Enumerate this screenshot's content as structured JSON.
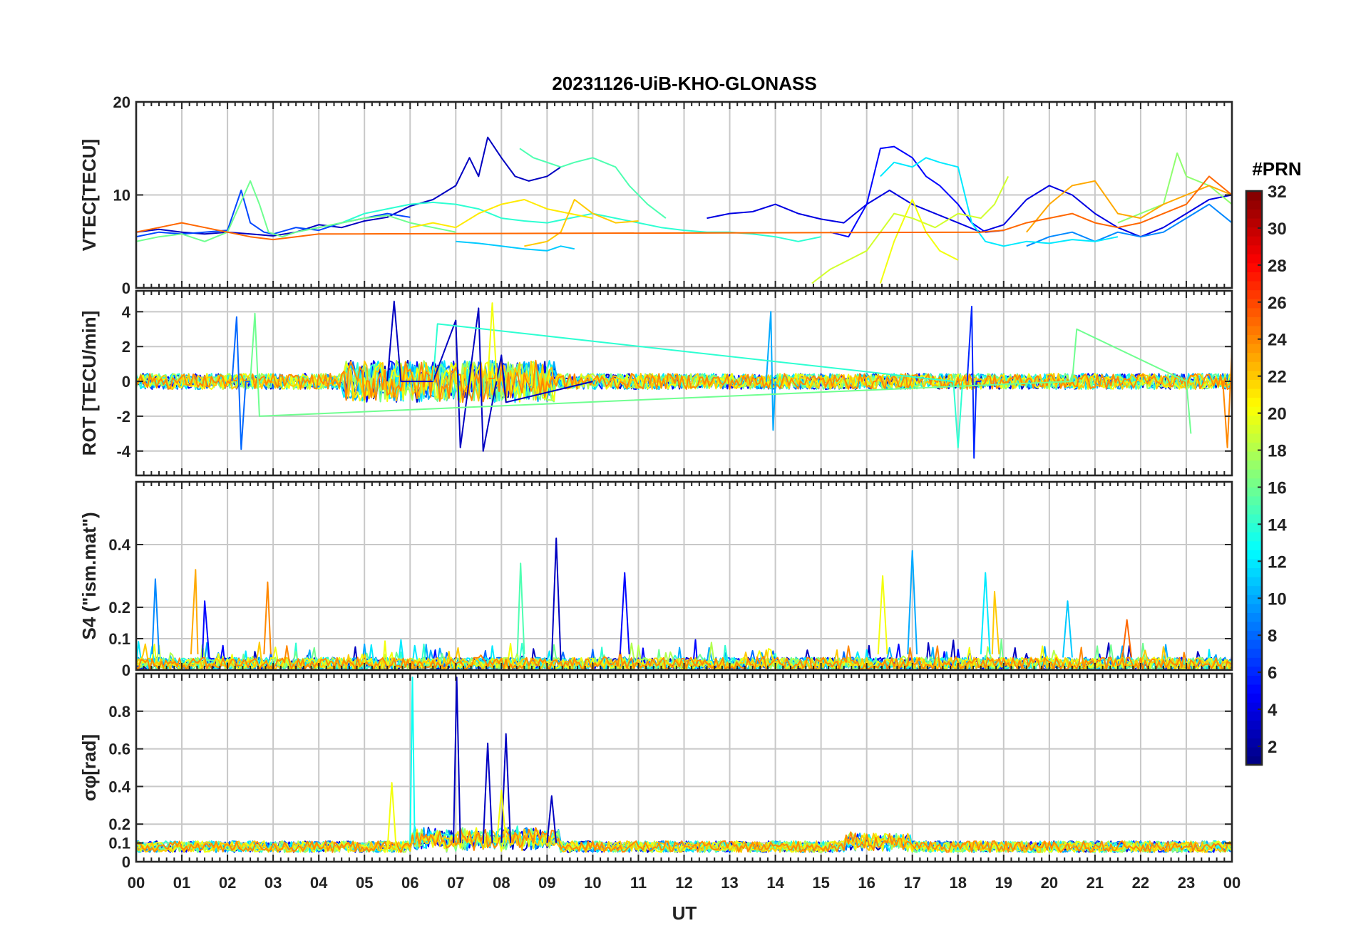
{
  "chart_data": {
    "type": "line",
    "title": "20231126-UiB-KHO-GLONASS",
    "xlabel": "UT",
    "x_tick_labels": [
      "00",
      "01",
      "02",
      "03",
      "04",
      "05",
      "06",
      "07",
      "08",
      "09",
      "10",
      "11",
      "12",
      "13",
      "14",
      "15",
      "16",
      "17",
      "18",
      "19",
      "20",
      "21",
      "22",
      "23",
      "00"
    ],
    "xlim": [
      0,
      24
    ],
    "colorbar": {
      "title": "#PRN",
      "range": [
        1,
        32
      ],
      "ticks": [
        2,
        4,
        6,
        8,
        10,
        12,
        14,
        16,
        18,
        20,
        22,
        24,
        26,
        28,
        30,
        32
      ],
      "colormap": "jet"
    },
    "panels": [
      {
        "id": "vtec",
        "ylabel": "VTEC[TECU]",
        "ylim": [
          0,
          20
        ],
        "yticks": [
          0,
          10,
          20
        ],
        "series": [
          {
            "prn": 3,
            "x": [
              0,
              0.5,
              1,
              1.5,
              2,
              2.5,
              3,
              3.5,
              4,
              4.5,
              5,
              5.5,
              6,
              6.5,
              7,
              7.3,
              7.5,
              7.7,
              8,
              8.3,
              8.6,
              9,
              9.3
            ],
            "y": [
              6,
              6.3,
              6,
              5.8,
              6,
              5.8,
              5.6,
              6,
              6.8,
              6.5,
              7.2,
              7.6,
              8.8,
              9.5,
              11,
              14,
              12,
              16.2,
              14,
              12,
              11.5,
              12,
              13
            ]
          },
          {
            "prn": 4,
            "x": [
              12.5,
              13,
              13.5,
              14,
              14.5,
              15,
              15.5,
              16,
              16.5,
              17,
              17.5,
              18,
              18.5,
              19,
              19.5,
              20,
              20.5,
              21,
              21.5,
              22,
              22.5,
              23,
              23.5,
              24
            ],
            "y": [
              7.5,
              8,
              8.2,
              9,
              8,
              7.4,
              7,
              9,
              10.5,
              9,
              8,
              7,
              6,
              6.8,
              9.5,
              11,
              10,
              8,
              6.5,
              5.5,
              6.5,
              8,
              9.5,
              10
            ]
          },
          {
            "prn": 5,
            "x": [
              15.2,
              15.6,
              16,
              16.3,
              16.6,
              17,
              17.3,
              17.6,
              18,
              18.3,
              18.6,
              19
            ],
            "y": [
              6,
              5.5,
              9,
              15,
              15.2,
              14,
              12,
              11,
              9,
              7,
              6,
              6.2
            ]
          },
          {
            "prn": 7,
            "x": [
              0,
              0.5,
              1,
              1.5,
              2,
              2.3,
              2.5,
              2.8,
              3,
              3.5,
              4,
              4.5,
              5,
              5.5,
              6
            ],
            "y": [
              5.5,
              6,
              5.8,
              6,
              6.2,
              10.5,
              7,
              6,
              5.8,
              6.5,
              6.2,
              7,
              7.5,
              8,
              7.6
            ]
          },
          {
            "prn": 9,
            "x": [
              19.5,
              20,
              20.5,
              21,
              21.5,
              22,
              22.5,
              23,
              23.5,
              24
            ],
            "y": [
              4.5,
              5.5,
              6,
              5,
              6,
              5.5,
              6,
              7.5,
              9,
              7
            ]
          },
          {
            "prn": 11,
            "x": [
              7,
              7.5,
              8,
              8.5,
              9,
              9.3,
              9.6
            ],
            "y": [
              5,
              4.8,
              4.5,
              4.2,
              4,
              4.5,
              4.2
            ]
          },
          {
            "prn": 12,
            "x": [
              16.3,
              16.6,
              17,
              17.3,
              17.6,
              18,
              18.3,
              18.6,
              19,
              19.5,
              20,
              20.5,
              21,
              21.5
            ],
            "y": [
              12,
              13.5,
              13,
              14,
              13.5,
              13,
              7,
              5,
              4.5,
              5,
              4.8,
              5.2,
              5,
              5.5
            ]
          },
          {
            "prn": 14,
            "x": [
              3.5,
              4,
              4.5,
              5,
              5.5,
              6,
              6.5,
              7,
              7.5,
              8,
              8.5,
              9,
              9.5,
              10,
              10.5,
              11,
              11.5,
              12,
              12.5,
              13,
              13.5,
              14,
              14.5,
              15
            ],
            "y": [
              6,
              6.5,
              7,
              8,
              8.5,
              9,
              9.2,
              9,
              8.5,
              7.5,
              7.2,
              7,
              7.5,
              8,
              7.5,
              7,
              6.5,
              6.2,
              6,
              6,
              5.8,
              5.5,
              5,
              5.5
            ]
          },
          {
            "prn": 15,
            "x": [
              8.4,
              8.7,
              9,
              9.3,
              9.6,
              10,
              10.5,
              10.8,
              11.2,
              11.6
            ],
            "y": [
              15,
              14,
              13.5,
              13,
              13.5,
              14,
              13,
              11,
              9,
              7.5
            ]
          },
          {
            "prn": 16,
            "x": [
              0,
              0.5,
              1,
              1.5,
              2,
              2.5,
              2.7,
              2.9,
              3.2,
              3.5,
              4,
              4.5,
              5,
              5.5,
              6,
              6.5,
              7
            ],
            "y": [
              5,
              5.5,
              5.8,
              5,
              6,
              11.5,
              9,
              6,
              5.5,
              6,
              6.5,
              7,
              7.5,
              7.8,
              7,
              6.5,
              6
            ]
          },
          {
            "prn": 17,
            "x": [
              21.5,
              22,
              22.5,
              22.8,
              23,
              23.5,
              24
            ],
            "y": [
              7,
              8,
              9,
              14.5,
              12,
              11,
              9
            ]
          },
          {
            "prn": 19,
            "x": [
              14.8,
              15.2,
              15.6,
              16,
              16.3,
              16.6,
              17,
              17.5,
              18,
              18.5,
              18.8,
              19.1
            ],
            "y": [
              0.5,
              2,
              3,
              4,
              6,
              8,
              7.5,
              6.5,
              8,
              7.5,
              9,
              12
            ]
          },
          {
            "prn": 20,
            "x": [
              16.3,
              16.6,
              17,
              17.3,
              17.6,
              18
            ],
            "y": [
              0.5,
              5,
              9.5,
              6,
              4,
              3
            ]
          },
          {
            "prn": 21,
            "x": [
              6,
              6.5,
              7,
              7.5,
              8,
              8.5,
              9,
              9.5,
              10
            ],
            "y": [
              6.5,
              7,
              6.5,
              8,
              9,
              9.5,
              8.5,
              8,
              7.5
            ]
          },
          {
            "prn": 22,
            "x": [
              8.5,
              9,
              9.3,
              9.6,
              10,
              10.5,
              11
            ],
            "y": [
              4.5,
              5,
              6,
              9.5,
              8,
              7,
              7.2
            ]
          },
          {
            "prn": 23,
            "x": [
              19.5,
              20,
              20.5,
              21,
              21.5,
              22,
              22.5,
              23,
              23.5,
              24
            ],
            "y": [
              6,
              9,
              11,
              11.5,
              8,
              7.5,
              9,
              10,
              11,
              10
            ]
          },
          {
            "prn": 25,
            "x": [
              0,
              0.5,
              1,
              1.5,
              2,
              2.5,
              3,
              3.5,
              4,
              18.5,
              19,
              19.5,
              20,
              20.5,
              21,
              21.5,
              22,
              22.5,
              23,
              23.5,
              24
            ],
            "y": [
              6,
              6.5,
              7,
              6.5,
              6,
              5.5,
              5.2,
              5.5,
              5.8,
              6,
              6.2,
              7,
              7.5,
              8,
              7,
              6.5,
              7,
              8,
              9,
              12,
              10
            ]
          }
        ]
      },
      {
        "id": "rot",
        "ylabel": "ROT [TECU/min]",
        "ylim": [
          -5.4,
          5.2
        ],
        "yticks": [
          -4,
          -2,
          0,
          2,
          4
        ],
        "series": [
          {
            "prn": 3,
            "x": [
              5.5,
              5.65,
              5.8,
              6.5,
              7,
              7.1,
              7.5,
              7.6,
              8,
              8.1,
              10
            ],
            "y": [
              0,
              4.6,
              0,
              0,
              3.5,
              -3.8,
              4.2,
              -4,
              1.5,
              -1.2,
              0
            ]
          },
          {
            "prn": 6,
            "x": [
              18.2,
              18.3,
              18.35,
              18.4,
              18.5
            ],
            "y": [
              0,
              4.3,
              -4.4,
              0,
              0
            ]
          },
          {
            "prn": 8,
            "x": [
              2.1,
              2.2,
              2.3,
              2.4,
              2.5
            ],
            "y": [
              0,
              3.7,
              -3.9,
              0,
              0
            ]
          },
          {
            "prn": 10,
            "x": [
              13.8,
              13.9,
              13.95,
              14
            ],
            "y": [
              0,
              4,
              -2.8,
              0
            ]
          },
          {
            "prn": 14,
            "x": [
              6.5,
              6.6,
              17.9,
              18,
              18.1
            ],
            "y": [
              0,
              3.3,
              0,
              -3.8,
              0
            ]
          },
          {
            "prn": 16,
            "x": [
              2.5,
              2.6,
              2.7,
              20.5,
              20.6,
              23,
              23.1
            ],
            "y": [
              0,
              3.9,
              -2,
              0,
              3,
              0,
              -3
            ]
          },
          {
            "prn": 20,
            "x": [
              7.7,
              7.8,
              7.9
            ],
            "y": [
              0,
              4.5,
              0
            ]
          },
          {
            "prn": 24,
            "x": [
              23.8,
              23.9,
              24
            ],
            "y": [
              0,
              -3.8,
              1.8
            ]
          }
        ],
        "band_note": "dense noise within about ±1 TECU/min across 00-24 UT"
      },
      {
        "id": "s4",
        "ylabel": "S4 (\"ism.mat\")",
        "ylim": [
          0,
          0.6
        ],
        "yticks": [
          0,
          0.1,
          0.2,
          0.4
        ],
        "series": [
          {
            "prn": 9,
            "x": [
              0.35,
              0.42,
              0.5
            ],
            "y": [
              0.05,
              0.29,
              0.05
            ]
          },
          {
            "prn": 23,
            "x": [
              1.2,
              1.3,
              1.35
            ],
            "y": [
              0.05,
              0.32,
              0.05
            ]
          },
          {
            "prn": 5,
            "x": [
              1.45,
              1.5,
              1.6
            ],
            "y": [
              0.04,
              0.22,
              0.04
            ]
          },
          {
            "prn": 24,
            "x": [
              2.8,
              2.88,
              2.95
            ],
            "y": [
              0.05,
              0.28,
              0.05
            ]
          },
          {
            "prn": 15,
            "x": [
              8.35,
              8.42,
              8.5
            ],
            "y": [
              0.05,
              0.34,
              0.05
            ]
          },
          {
            "prn": 3,
            "x": [
              9.1,
              9.2,
              9.3
            ],
            "y": [
              0.03,
              0.42,
              0.03
            ]
          },
          {
            "prn": 5,
            "x": [
              10.6,
              10.7,
              10.8
            ],
            "y": [
              0.05,
              0.31,
              0.05
            ]
          },
          {
            "prn": 20,
            "x": [
              16.25,
              16.35,
              16.45
            ],
            "y": [
              0.05,
              0.3,
              0.05
            ]
          },
          {
            "prn": 10,
            "x": [
              16.9,
              17,
              17.1
            ],
            "y": [
              0.05,
              0.38,
              0.05
            ]
          },
          {
            "prn": 12,
            "x": [
              18.5,
              18.6,
              18.7
            ],
            "y": [
              0.05,
              0.31,
              0.05
            ]
          },
          {
            "prn": 22,
            "x": [
              18.75,
              18.8,
              18.9
            ],
            "y": [
              0.05,
              0.25,
              0.05
            ]
          },
          {
            "prn": 11,
            "x": [
              20.3,
              20.4,
              20.5
            ],
            "y": [
              0.04,
              0.22,
              0.04
            ]
          },
          {
            "prn": 25,
            "x": [
              21.6,
              21.7,
              21.8
            ],
            "y": [
              0.04,
              0.16,
              0.04
            ]
          }
        ],
        "band_note": "baseline between 0 and about 0.06"
      },
      {
        "id": "sigma_phi",
        "ylabel": "σφ[rad]",
        "ylim": [
          0,
          1.0
        ],
        "yticks": [
          0,
          0.1,
          0.2,
          0.4,
          0.6,
          0.8
        ],
        "series": [
          {
            "prn": 13,
            "x": [
              6,
              6.05,
              6.1
            ],
            "y": [
              0.1,
              0.98,
              0.1
            ]
          },
          {
            "prn": 3,
            "x": [
              6.95,
              7.02,
              7.1
            ],
            "y": [
              0.1,
              0.98,
              0.1
            ]
          },
          {
            "prn": 3,
            "x": [
              7.6,
              7.7,
              7.8
            ],
            "y": [
              0.1,
              0.63,
              0.1
            ]
          },
          {
            "prn": 3,
            "x": [
              8,
              8.1,
              8.2
            ],
            "y": [
              0.1,
              0.68,
              0.1
            ]
          },
          {
            "prn": 20,
            "x": [
              7.9,
              8,
              8.1
            ],
            "y": [
              0.1,
              0.38,
              0.1
            ]
          },
          {
            "prn": 3,
            "x": [
              9,
              9.1,
              9.2
            ],
            "y": [
              0.1,
              0.35,
              0.1
            ]
          },
          {
            "prn": 20,
            "x": [
              5.5,
              5.6,
              5.7
            ],
            "y": [
              0.05,
              0.42,
              0.05
            ]
          }
        ],
        "band_note": "baseline between 0 and about 0.15; elevated 06-09 and 15.5-17 UT"
      }
    ]
  }
}
